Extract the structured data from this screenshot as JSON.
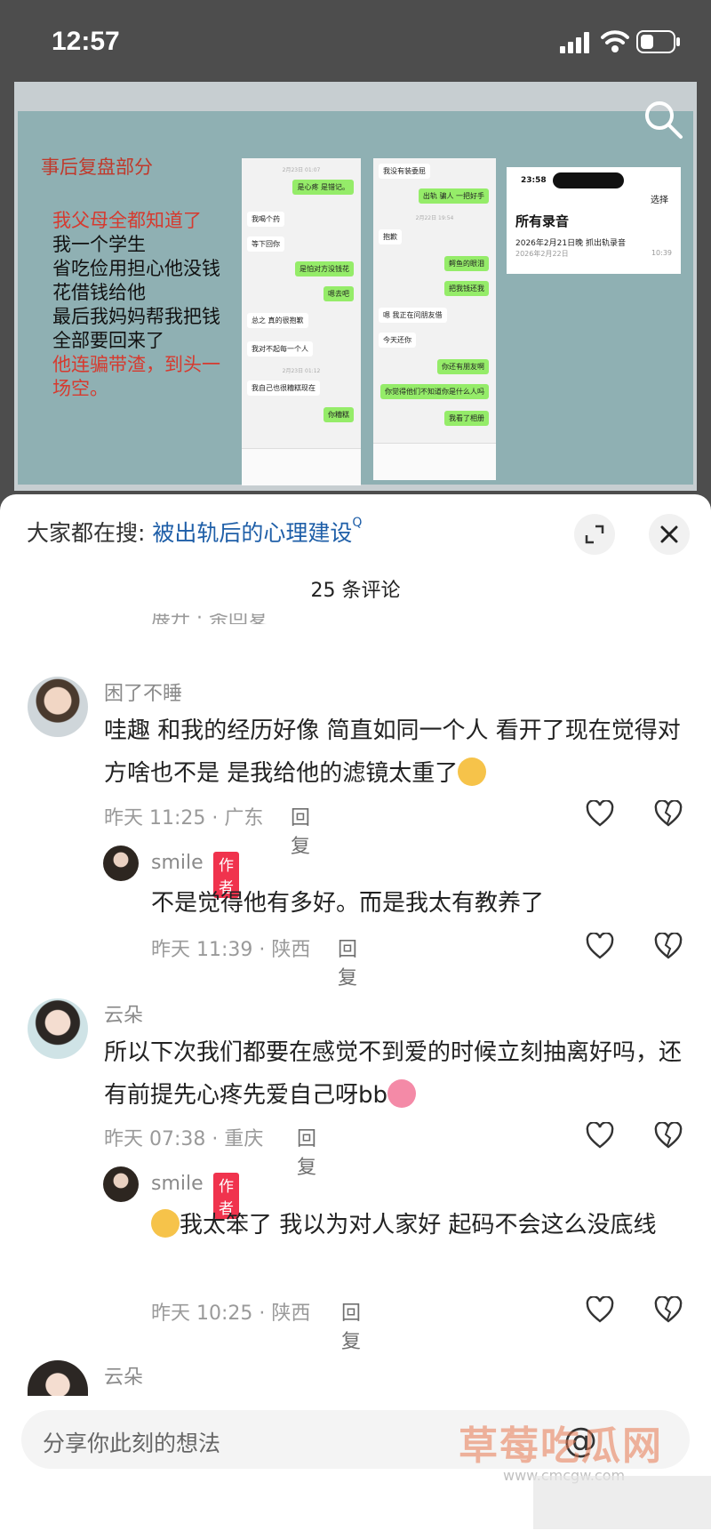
{
  "status_bar": {
    "time": "12:57"
  },
  "slide": {
    "title": "事后复盘部分",
    "lines": [
      {
        "text": "我父母全都知道了",
        "red": true
      },
      {
        "text": "我一个学生",
        "red": false
      },
      {
        "text": "省吃俭用担心他没钱",
        "red": false
      },
      {
        "text": "花借钱给他",
        "red": false
      },
      {
        "text": "最后我妈妈帮我把钱",
        "red": false
      },
      {
        "text": "全部要回来了",
        "red": false
      },
      {
        "text": "他连骗带渣，到头一",
        "red": true
      },
      {
        "text": "场空。",
        "red": true
      }
    ],
    "chat_a": {
      "ts1": "2月23日 01:07",
      "m1": "是心疼 是错记。",
      "m2": "我喝个药",
      "m3": "等下回你",
      "m4": "是怕对方没钱花",
      "m5": "嗯去吧",
      "m6": "总之 真的很抱歉",
      "m7": "我对不起每一个人",
      "ts2": "2月23日 01:12",
      "m8": "我自己也很糟糕现在",
      "m9": "你糟糕"
    },
    "chat_b": {
      "m1": "我没有装委屈",
      "m2": "出轨 骗人 一把好手",
      "ts1": "2月22日 19:54",
      "m3": "抱歉",
      "m4": "鳄鱼的眼泪",
      "m5": "把我钱还我",
      "m6": "嗯 我正在问朋友借",
      "m7": "今天还你",
      "m8": "你还有朋友啊",
      "m9": "你觉得他们不知道你是什么人吗",
      "m10": "我看了相册"
    },
    "recorder": {
      "time": "23:58",
      "select": "选择",
      "title": "所有录音",
      "item": "2026年2月21日晚 抓出轨录音",
      "date": "2026年2月22日",
      "duration": "10:39"
    }
  },
  "sheet": {
    "search_prefix": "大家都在搜: ",
    "search_keyword": "被出轨后的心理建设",
    "search_suffix": "Q",
    "comment_count": "25 条评论",
    "cut_text": "展开 · 条回复"
  },
  "comments": [
    {
      "user": "困了不睡",
      "text": "哇趣 和我的经历好像 简直如同一个人 看开了现在觉得对方啥也不是 是我给他的滤镜太重了",
      "time": "昨天 11:25 · 广东",
      "reply": "回复"
    },
    {
      "user": "smile",
      "badge": "作者",
      "text": "不是觉得他有多好。而是我太有教养了",
      "time": "昨天 11:39 · 陕西",
      "reply": "回复"
    },
    {
      "user": "云朵",
      "text": "所以下次我们都要在感觉不到爱的时候立刻抽离好吗，还有前提先心疼先爱自己呀bb",
      "time": "昨天 07:38 · 重庆",
      "reply": "回复"
    },
    {
      "user": "smile",
      "badge": "作者",
      "text": "我太笨了 我以为对人家好 起码不会这么没底线",
      "time": "昨天 10:25 · 陕西",
      "reply": "回复"
    },
    {
      "user": "云朵"
    }
  ],
  "input": {
    "placeholder": "分享你此刻的想法",
    "at": "@"
  },
  "watermark": {
    "text": "草莓吃瓜网",
    "url": "www.cmcgw.com"
  },
  "colors": {
    "author_badge": "#f0334d",
    "keyword": "#1f5fa8",
    "slide_bg": "#8fb0b3",
    "wechat_green": "#95ec69"
  }
}
